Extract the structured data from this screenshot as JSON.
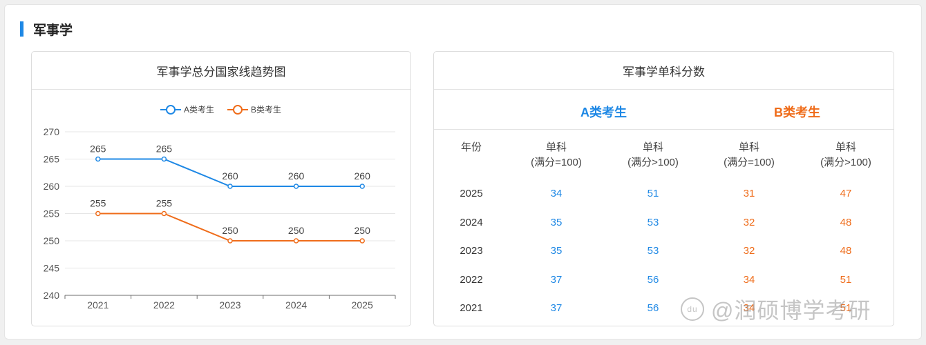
{
  "section": {
    "title": "军事学"
  },
  "left_card": {
    "title": "军事学总分国家线趋势图"
  },
  "right_card": {
    "title": "军事学单科分数",
    "group_a": "A类考生",
    "group_b": "B类考生",
    "headers": {
      "year": "年份",
      "a1": [
        "单科",
        "(满分=100)"
      ],
      "a2": [
        "单科",
        "(满分>100)"
      ],
      "b1": [
        "单科",
        "(满分=100)"
      ],
      "b2": [
        "单科",
        "(满分>100)"
      ]
    },
    "rows": [
      {
        "year": "2025",
        "a1": "34",
        "a2": "51",
        "b1": "31",
        "b2": "47"
      },
      {
        "year": "2024",
        "a1": "35",
        "a2": "53",
        "b1": "32",
        "b2": "48"
      },
      {
        "year": "2023",
        "a1": "35",
        "a2": "53",
        "b1": "32",
        "b2": "48"
      },
      {
        "year": "2022",
        "a1": "37",
        "a2": "56",
        "b1": "34",
        "b2": "51"
      },
      {
        "year": "2021",
        "a1": "37",
        "a2": "56",
        "b1": "34",
        "b2": "51"
      }
    ]
  },
  "chart_data": {
    "type": "line",
    "title": "军事学总分国家线趋势图",
    "categories": [
      "2021",
      "2022",
      "2023",
      "2024",
      "2025"
    ],
    "series": [
      {
        "name": "A类考生",
        "color": "#1e88e5",
        "values": [
          265,
          265,
          260,
          260,
          260
        ]
      },
      {
        "name": "B类考生",
        "color": "#ef6c1a",
        "values": [
          255,
          255,
          250,
          250,
          250
        ]
      }
    ],
    "ylim": [
      240,
      270
    ],
    "yticks": [
      240,
      245,
      250,
      255,
      260,
      265,
      270
    ],
    "legend": "top-center",
    "grid": true,
    "data_labels": true
  },
  "watermark": {
    "text": "@润硕博学考研",
    "logo": "du"
  },
  "colors": {
    "accent": "#1e88e5",
    "series_b": "#ef6c1a"
  }
}
